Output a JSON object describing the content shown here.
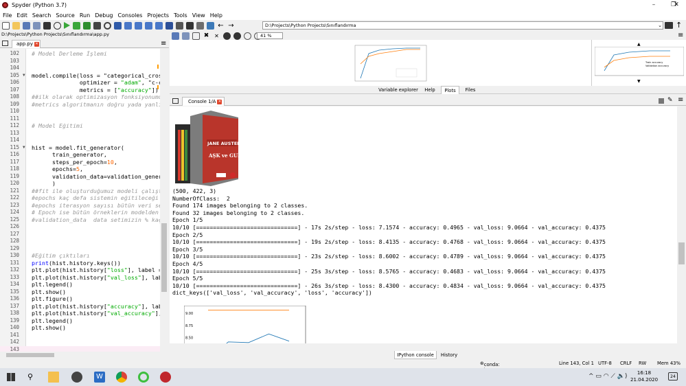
{
  "window": {
    "title": "Spyder (Python 3.7)",
    "controls": {
      "minimize": "–",
      "maximize": "❐",
      "close": "✕"
    }
  },
  "menu": [
    "File",
    "Edit",
    "Search",
    "Source",
    "Run",
    "Debug",
    "Consoles",
    "Projects",
    "Tools",
    "View",
    "Help"
  ],
  "toolbar": {
    "path": "D:\\Projects\\Python Projects\\Sınıflandırma"
  },
  "editor": {
    "file_path": "D:\\Projects\\Python Projects\\Sınıflandırma\\app.py",
    "tab": "app.py",
    "lines": [
      {
        "n": "102",
        "t": "# Model Derleme İşlemi",
        "k": "cm"
      },
      {
        "n": "103",
        "t": ""
      },
      {
        "n": "104",
        "t": ""
      },
      {
        "n": "105",
        "t": "model.compile(loss = \"categorical_cross",
        "k": "mixed1"
      },
      {
        "n": "106",
        "t": "              optimizer = \"adam\", #Ağır",
        "k": "mixed2"
      },
      {
        "n": "107",
        "t": "              metrics = [\"accuracy\"])",
        "k": "mixed3"
      },
      {
        "n": "108",
        "t": "##ilk olarak optimizasyon fonksiyonumu",
        "k": "cm"
      },
      {
        "n": "109",
        "t": "#metrics algoritmanın doğru yada yanlış",
        "k": "cm"
      },
      {
        "n": "110",
        "t": ""
      },
      {
        "n": "111",
        "t": ""
      },
      {
        "n": "112",
        "t": "# Model Eğitimi",
        "k": "cm"
      },
      {
        "n": "113",
        "t": ""
      },
      {
        "n": "114",
        "t": ""
      },
      {
        "n": "115",
        "t": "hist = model.fit_generator("
      },
      {
        "n": "116",
        "t": "      train_generator,"
      },
      {
        "n": "117",
        "t": "      steps_per_epoch=10,",
        "k": "num10"
      },
      {
        "n": "118",
        "t": "      epochs=5,",
        "k": "num5"
      },
      {
        "n": "119",
        "t": "      validation_data=validation_genera"
      },
      {
        "n": "120",
        "t": "      )"
      },
      {
        "n": "121",
        "t": "##fit ile oluşturduğumuz modeli çalıştı",
        "k": "cm"
      },
      {
        "n": "122",
        "t": "#epochs kaç defa sistemin eğitileceği",
        "k": "cm"
      },
      {
        "n": "123",
        "t": "#epochs iterasyon sayısı bütün veri set",
        "k": "cm"
      },
      {
        "n": "124",
        "t": "# Epoch ise bütün örneklerin modelden k",
        "k": "cm"
      },
      {
        "n": "125",
        "t": "#validation_data  data setimizin % kaçı",
        "k": "cm"
      },
      {
        "n": "126",
        "t": ""
      },
      {
        "n": "127",
        "t": ""
      },
      {
        "n": "128",
        "t": ""
      },
      {
        "n": "129",
        "t": ""
      },
      {
        "n": "130",
        "t": "#Eğitim çıktıları",
        "k": "cm"
      },
      {
        "n": "131",
        "t": "print(hist.history.keys())",
        "k": "print"
      },
      {
        "n": "132",
        "t": "plt.plot(hist.history[\"loss\"], label = ",
        "k": "s_loss"
      },
      {
        "n": "133",
        "t": "plt.plot(hist.history[\"val_loss\"], labe",
        "k": "s_vloss"
      },
      {
        "n": "134",
        "t": "plt.legend()"
      },
      {
        "n": "135",
        "t": "plt.show()"
      },
      {
        "n": "136",
        "t": "plt.figure()"
      },
      {
        "n": "137",
        "t": "plt.plot(hist.history[\"accuracy\"], labe",
        "k": "s_acc"
      },
      {
        "n": "138",
        "t": "plt.plot(hist.history[\"val_accuracy\"],",
        "k": "s_vacc"
      },
      {
        "n": "139",
        "t": "plt.legend()"
      },
      {
        "n": "140",
        "t": "plt.show()"
      },
      {
        "n": "141",
        "t": ""
      },
      {
        "n": "142",
        "t": ""
      },
      {
        "n": "143",
        "t": "",
        "k": "cur"
      }
    ]
  },
  "plots": {
    "zoom": "41 %",
    "thumb_legend": [
      "Train accuracy",
      "Validation accuracy"
    ]
  },
  "pane_tabs": [
    "Variable explorer",
    "Help",
    "Plots",
    "Files"
  ],
  "console": {
    "tab": "Console 1/A",
    "book": {
      "author": "JANE AUSTEN",
      "title": "AŞK ve GURUR"
    },
    "lines": [
      "(500, 422, 3)",
      "NumberOfClass:  2",
      "Found 174 images belonging to 2 classes.",
      "Found 32 images belonging to 2 classes.",
      "Epoch 1/5",
      "10/10 [==============================] - 17s 2s/step - loss: 7.1574 - accuracy: 0.4965 - val_loss: 9.0664 - val_accuracy: 0.4375",
      "Epoch 2/5",
      "10/10 [==============================] - 19s 2s/step - loss: 8.4135 - accuracy: 0.4768 - val_loss: 9.0664 - val_accuracy: 0.4375",
      "Epoch 3/5",
      "10/10 [==============================] - 23s 2s/step - loss: 8.6002 - accuracy: 0.4789 - val_loss: 9.0664 - val_accuracy: 0.4375",
      "Epoch 4/5",
      "10/10 [==============================] - 25s 3s/step - loss: 8.5765 - accuracy: 0.4683 - val_loss: 9.0664 - val_accuracy: 0.4375",
      "Epoch 5/5",
      "10/10 [==============================] - 26s 3s/step - loss: 8.4300 - accuracy: 0.4834 - val_loss: 9.0664 - val_accuracy: 0.4375",
      "dict_keys(['val_loss', 'val_accuracy', 'loss', 'accuracy'])"
    ],
    "loss_plot": {
      "ticks": [
        "9.00",
        "8.75",
        "8.50",
        "8.25"
      ],
      "series": [
        {
          "values": [
            9.0664,
            9.0664,
            9.0664,
            9.0664,
            9.0664
          ],
          "color": "#ff7f0e"
        },
        {
          "values": [
            7.1574,
            8.4135,
            8.4002,
            8.5765,
            8.43
          ],
          "color": "#1f77b4"
        }
      ]
    }
  },
  "bottom_tabs": [
    "IPython console",
    "History"
  ],
  "status": {
    "conda": "conda: base (Python 3.7.6)",
    "position": "Line 143, Col 1",
    "encoding": "UTF-8",
    "eol": "CRLF",
    "rw": "RW",
    "mem": "Mem 43%"
  },
  "taskbar": {
    "time": "16:18",
    "date": "21.04.2020",
    "notif_count": "24",
    "tray": "^ ▭ ◠ ⟋ 🔈)"
  }
}
